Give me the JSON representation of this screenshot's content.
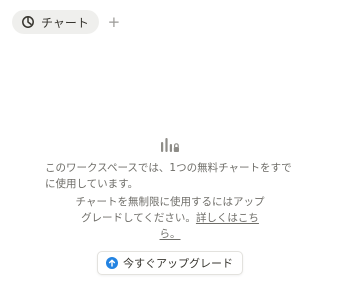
{
  "tabs": {
    "active_label": "チャート",
    "active_icon": "chart-pie-icon",
    "add_symbol": "+",
    "add_icon": "plus-icon"
  },
  "empty_state": {
    "icon": "chart-lock-icon",
    "message_line1": "このワークスペースでは、1つの無料チャートをすでに使用しています。",
    "message_line2_prefix": "チャートを無制限に使用するにはアップグレードしてください。",
    "learn_more": "詳しくはこちら。",
    "upgrade_button": "今すぐアップグレード",
    "upgrade_icon": "arrow-up-circle-icon"
  },
  "colors": {
    "accent": "#2383e2",
    "tab_bg": "#efefed",
    "muted_text": "#6f6e69"
  }
}
